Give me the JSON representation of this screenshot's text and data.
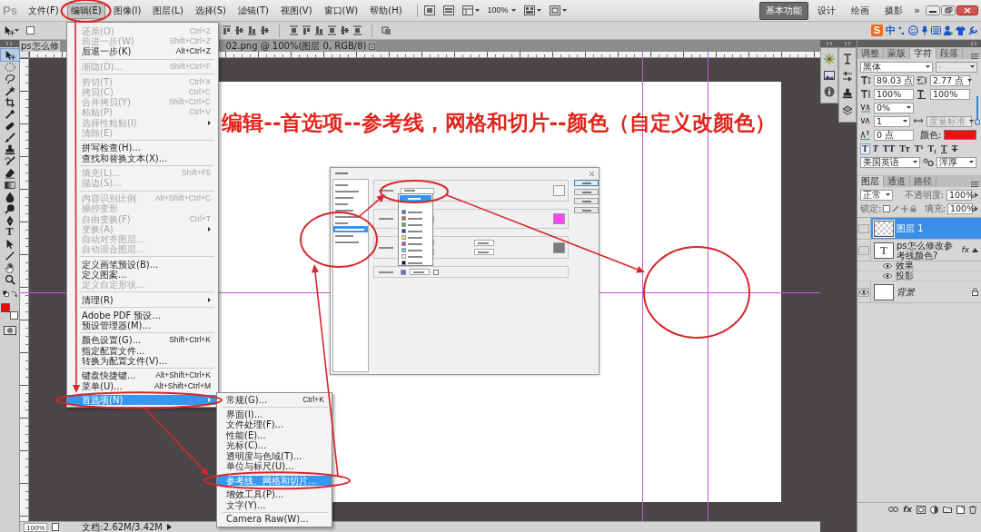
{
  "menu_bar": {
    "logo": "Ps",
    "items": [
      {
        "label": "文件(F)",
        "selected": false
      },
      {
        "label": "编辑(E)",
        "selected": true
      },
      {
        "label": "图像(I)",
        "selected": false
      },
      {
        "label": "图层(L)",
        "selected": false
      },
      {
        "label": "选择(S)",
        "selected": false
      },
      {
        "label": "滤镜(T)",
        "selected": false
      },
      {
        "label": "视图(V)",
        "selected": false
      },
      {
        "label": "窗口(W)",
        "selected": false
      },
      {
        "label": "帮助(H)",
        "selected": false
      }
    ],
    "zoom": "100%",
    "workspaces": [
      {
        "label": "基本功能",
        "selected": true
      },
      {
        "label": "设计",
        "selected": false
      },
      {
        "label": "绘画",
        "selected": false
      },
      {
        "label": "摄影",
        "selected": false
      }
    ],
    "more": "»"
  },
  "options_bar": {
    "auto_select": {
      "checked": false
    }
  },
  "ime_bar": {
    "logo": "S",
    "mode": "中"
  },
  "toolbar": {
    "tools": [
      {
        "kind": "move",
        "selected": true
      },
      {
        "kind": "ellipse-marquee",
        "selected": false
      },
      {
        "kind": "lasso",
        "selected": false
      },
      {
        "kind": "quick-select",
        "selected": false
      },
      {
        "kind": "crop",
        "selected": false
      },
      {
        "kind": "eyedropper",
        "selected": false
      },
      {
        "kind": "healing",
        "selected": false
      },
      {
        "kind": "brush",
        "selected": false
      },
      {
        "kind": "stamp",
        "selected": false
      },
      {
        "kind": "history-brush",
        "selected": false
      },
      {
        "kind": "eraser",
        "selected": false
      },
      {
        "kind": "gradient",
        "selected": false
      },
      {
        "kind": "blur",
        "selected": false
      },
      {
        "kind": "dodge",
        "selected": false
      },
      {
        "kind": "pen",
        "selected": false
      },
      {
        "kind": "type",
        "label": "T",
        "selected": false
      },
      {
        "kind": "path-select",
        "selected": false
      },
      {
        "kind": "line",
        "selected": false
      },
      {
        "kind": "hand",
        "selected": false
      },
      {
        "kind": "zoom",
        "selected": false
      }
    ]
  },
  "document_tabs": [
    {
      "label": "ps怎么修",
      "selected": true
    },
    {
      "label": "02.png @ 100%(图层 0, RGB/8)",
      "selected": false
    }
  ],
  "edit_menu": {
    "items": [
      {
        "kind": "item",
        "label": "还原(O)",
        "shortcut": "Ctrl+Z",
        "disabled": true,
        "selected": false
      },
      {
        "kind": "item",
        "label": "前进一步(W)",
        "shortcut": "Shift+Ctrl+Z",
        "disabled": true,
        "selected": false
      },
      {
        "kind": "item",
        "label": "后退一步(K)",
        "shortcut": "Alt+Ctrl+Z",
        "disabled": false,
        "selected": false
      },
      {
        "kind": "separator"
      },
      {
        "kind": "item",
        "label": "渐隐(D)...",
        "shortcut": "Shift+Ctrl+F",
        "disabled": true,
        "selected": false
      },
      {
        "kind": "separator"
      },
      {
        "kind": "item",
        "label": "剪切(T)",
        "shortcut": "Ctrl+X",
        "disabled": true,
        "selected": false
      },
      {
        "kind": "item",
        "label": "拷贝(C)",
        "shortcut": "Ctrl+C",
        "disabled": true,
        "selected": false
      },
      {
        "kind": "item",
        "label": "合并拷贝(Y)",
        "shortcut": "Shift+Ctrl+C",
        "disabled": true,
        "selected": false
      },
      {
        "kind": "item",
        "label": "粘贴(P)",
        "shortcut": "Ctrl+V",
        "disabled": true,
        "selected": false
      },
      {
        "kind": "item",
        "label": "选择性粘贴(I)",
        "submenu": true,
        "disabled": true,
        "selected": false
      },
      {
        "kind": "item",
        "label": "清除(E)",
        "disabled": true,
        "selected": false
      },
      {
        "kind": "separator"
      },
      {
        "kind": "item",
        "label": "拼写检查(H)...",
        "disabled": false,
        "selected": false
      },
      {
        "kind": "item",
        "label": "查找和替换文本(X)...",
        "disabled": false,
        "selected": false
      },
      {
        "kind": "separator"
      },
      {
        "kind": "item",
        "label": "填充(L)...",
        "shortcut": "Shift+F5",
        "disabled": true,
        "selected": false
      },
      {
        "kind": "item",
        "label": "描边(S)...",
        "disabled": true,
        "selected": false
      },
      {
        "kind": "separator"
      },
      {
        "kind": "item",
        "label": "内容识别比例",
        "shortcut": "Alt+Shift+Ctrl+C",
        "disabled": true,
        "selected": false
      },
      {
        "kind": "item",
        "label": "操控变形",
        "disabled": true,
        "selected": false
      },
      {
        "kind": "item",
        "label": "自由变换(F)",
        "shortcut": "Ctrl+T",
        "disabled": true,
        "selected": false
      },
      {
        "kind": "item",
        "label": "变换(A)",
        "submenu": true,
        "disabled": true,
        "selected": false
      },
      {
        "kind": "item",
        "label": "自动对齐图层...",
        "disabled": true,
        "selected": false
      },
      {
        "kind": "item",
        "label": "自动混合图层...",
        "disabled": true,
        "selected": false
      },
      {
        "kind": "separator"
      },
      {
        "kind": "item",
        "label": "定义画笔预设(B)...",
        "disabled": false,
        "selected": false
      },
      {
        "kind": "item",
        "label": "定义图案...",
        "disabled": false,
        "selected": false
      },
      {
        "kind": "item",
        "label": "定义自定形状...",
        "disabled": true,
        "selected": false
      },
      {
        "kind": "separator"
      },
      {
        "kind": "item",
        "label": "清理(R)",
        "submenu": true,
        "disabled": false,
        "selected": false
      },
      {
        "kind": "separator"
      },
      {
        "kind": "item",
        "label": "Adobe PDF 预设...",
        "disabled": false,
        "selected": false
      },
      {
        "kind": "item",
        "label": "预设管理器(M)...",
        "disabled": false,
        "selected": false
      },
      {
        "kind": "separator"
      },
      {
        "kind": "item",
        "label": "颜色设置(G)...",
        "shortcut": "Shift+Ctrl+K",
        "disabled": false,
        "selected": false
      },
      {
        "kind": "item",
        "label": "指定配置文件...",
        "disabled": false,
        "selected": false
      },
      {
        "kind": "item",
        "label": "转换为配置文件(V)...",
        "disabled": false,
        "selected": false
      },
      {
        "kind": "separator"
      },
      {
        "kind": "item",
        "label": "键盘快捷键...",
        "shortcut": "Alt+Shift+Ctrl+K",
        "disabled": false,
        "selected": false
      },
      {
        "kind": "item",
        "label": "菜单(U)...",
        "shortcut": "Alt+Shift+Ctrl+M",
        "disabled": false,
        "selected": false
      },
      {
        "kind": "item",
        "label": "首选项(N)",
        "submenu": true,
        "disabled": false,
        "selected": true
      }
    ]
  },
  "preferences_submenu": {
    "items": [
      {
        "kind": "item",
        "label": "常规(G)...",
        "shortcut": "Ctrl+K",
        "disabled": false,
        "selected": false
      },
      {
        "kind": "separator"
      },
      {
        "kind": "item",
        "label": "界面(I)...",
        "disabled": false,
        "selected": false
      },
      {
        "kind": "item",
        "label": "文件处理(F)...",
        "disabled": false,
        "selected": false
      },
      {
        "kind": "item",
        "label": "性能(E)...",
        "disabled": false,
        "selected": false
      },
      {
        "kind": "item",
        "label": "光标(C)...",
        "disabled": false,
        "selected": false
      },
      {
        "kind": "item",
        "label": "透明度与色域(T)...",
        "disabled": false,
        "selected": false
      },
      {
        "kind": "item",
        "label": "单位与标尺(U)...",
        "disabled": false,
        "selected": false
      },
      {
        "kind": "item",
        "label": "参考线、网格和切片...",
        "disabled": false,
        "selected": true
      },
      {
        "kind": "item",
        "label": "增效工具(P)...",
        "disabled": false,
        "selected": false
      },
      {
        "kind": "item",
        "label": "文字(Y)...",
        "disabled": false,
        "selected": false
      },
      {
        "kind": "separator"
      },
      {
        "kind": "item",
        "label": "Camera Raw(W)...",
        "disabled": false,
        "selected": false
      }
    ]
  },
  "document": {
    "heading": "编辑--首选项--参考线，网格和切片--颜色（自定义改颜色）",
    "preferences_dialog": {
      "categories": [
        {
          "selected": false
        },
        {
          "selected": false
        },
        {
          "selected": false
        },
        {
          "selected": false
        },
        {
          "selected": false
        },
        {
          "selected": false
        },
        {
          "selected": false
        },
        {
          "selected": true
        },
        {
          "selected": false
        },
        {
          "selected": false
        }
      ],
      "groups": [
        {
          "kind": "guides",
          "color": "#f7f7f7"
        },
        {
          "kind": "smart-guides",
          "color": "#ff44f4"
        },
        {
          "kind": "grid",
          "color": "#7b7b7b"
        },
        {
          "kind": "slices",
          "color": "#4f73d8",
          "checked": false
        }
      ],
      "color_options": [
        {
          "kind": "custom",
          "selected": true
        },
        {
          "kind": "color",
          "color": "#4f73d8",
          "selected": false
        },
        {
          "kind": "color",
          "color": "#e2574c",
          "selected": false
        },
        {
          "kind": "color",
          "color": "#41c84b",
          "selected": false
        },
        {
          "kind": "color",
          "color": "#2a3aa8",
          "selected": false
        },
        {
          "kind": "color",
          "color": "#f2f04a",
          "selected": false
        },
        {
          "kind": "color",
          "color": "#c148c8",
          "selected": false
        },
        {
          "kind": "color",
          "color": "#49dcdc",
          "selected": false
        },
        {
          "kind": "color",
          "color": "#f4f4f4",
          "selected": false
        },
        {
          "kind": "color",
          "color": "#111111",
          "selected": false
        }
      ],
      "buttons": [
        {
          "kind": "default"
        },
        {
          "kind": "normal"
        },
        {
          "kind": "normal"
        },
        {
          "kind": "normal"
        }
      ]
    }
  },
  "character_panel": {
    "tabs": [
      {
        "label": "调整",
        "selected": false
      },
      {
        "label": "蒙版",
        "selected": false
      },
      {
        "label": "字符",
        "selected": true
      },
      {
        "label": "段落",
        "selected": false
      }
    ],
    "font_family": "黑体",
    "font_style": {
      "label": "-",
      "disabled": true
    },
    "size": "89.03 点",
    "leading": "2.77 点",
    "vertical_scale": "100%",
    "horizontal_scale": "100%",
    "tracking": "0%",
    "kerning": "1",
    "kerning_mode": {
      "label": "度量标准",
      "disabled": true
    },
    "baseline_shift": "0 点",
    "color_label": "颜色:",
    "style_buttons": [
      {
        "kind": "faux-bold",
        "label": "T",
        "selected": true
      },
      {
        "kind": "faux-italic",
        "label": "T",
        "selected": false
      },
      {
        "kind": "all-caps",
        "label": "TT",
        "selected": false
      },
      {
        "kind": "small-caps",
        "label": "Tᴛ",
        "selected": false
      },
      {
        "kind": "superscript",
        "label": "T¹",
        "selected": false
      },
      {
        "kind": "subscript",
        "label": "T₁",
        "selected": false
      },
      {
        "kind": "underline",
        "label": "T",
        "selected": false
      },
      {
        "kind": "strikethrough",
        "label": "T",
        "selected": false
      }
    ],
    "language": "美国英语",
    "antialias": "浑厚"
  },
  "layers_panel": {
    "tabs": [
      {
        "label": "图层",
        "selected": true
      },
      {
        "label": "通道",
        "selected": false
      },
      {
        "label": "路径",
        "selected": false
      }
    ],
    "blend_mode": "正常",
    "opacity_label": "不透明度:",
    "opacity": "100%",
    "lock_label": "锁定:",
    "fill_label": "填充:",
    "fill": "100%",
    "layers": [
      {
        "kind": "pixel",
        "name": "图层 1",
        "selected": true,
        "visible": false,
        "locked": false
      },
      {
        "kind": "text",
        "thumb": "T",
        "name": "ps怎么修改参考线颜色?",
        "fx": "fx",
        "expanded": true,
        "selected": false,
        "visible": false,
        "locked": false,
        "children": [
          {
            "name": "效果",
            "visible": true
          },
          {
            "name": "投影",
            "visible": true
          }
        ]
      },
      {
        "kind": "background",
        "name": "背景",
        "selected": false,
        "visible": true,
        "locked": true
      }
    ],
    "footer_fx": "fx"
  },
  "status_bar": {
    "zoom": "100%",
    "info": "文档:2.62M/3.42M"
  }
}
